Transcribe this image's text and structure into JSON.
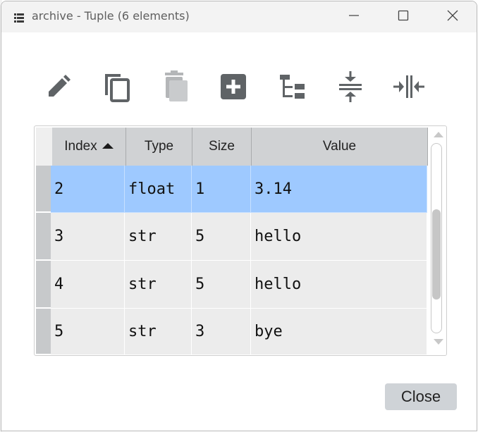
{
  "window": {
    "title": "archive - Tuple (6 elements)",
    "icon": "list-icon"
  },
  "toolbar": {
    "tools": [
      {
        "name": "edit-tool",
        "icon": "pencil-icon",
        "enabled": true
      },
      {
        "name": "copy-tool",
        "icon": "copy-icon",
        "enabled": true
      },
      {
        "name": "delete-tool",
        "icon": "trash-icon",
        "enabled": false
      },
      {
        "name": "insert-tool",
        "icon": "plus-box-icon",
        "enabled": true
      },
      {
        "name": "tree-view-tool",
        "icon": "tree-icon",
        "enabled": true
      },
      {
        "name": "collapse-tool",
        "icon": "collapse-vertical-icon",
        "enabled": true
      },
      {
        "name": "resize-columns-tool",
        "icon": "collapse-horizontal-icon",
        "enabled": true
      }
    ]
  },
  "table": {
    "headers": [
      "Index",
      "Type",
      "Size",
      "Value"
    ],
    "sorted_column": "Index",
    "sort_direction": "ascending",
    "rows": [
      {
        "index": "2",
        "type": "float",
        "size": "1",
        "value": "3.14",
        "selected": true
      },
      {
        "index": "3",
        "type": "str",
        "size": "5",
        "value": "hello",
        "selected": false
      },
      {
        "index": "4",
        "type": "str",
        "size": "5",
        "value": "hello",
        "selected": false
      },
      {
        "index": "5",
        "type": "str",
        "size": "3",
        "value": "bye",
        "selected": false
      }
    ]
  },
  "actions": {
    "close_label": "Close"
  },
  "colors": {
    "selection": "#9ec9ff",
    "header": "#d0d2d4",
    "cell": "#ececec",
    "icon": "#5f6366"
  }
}
